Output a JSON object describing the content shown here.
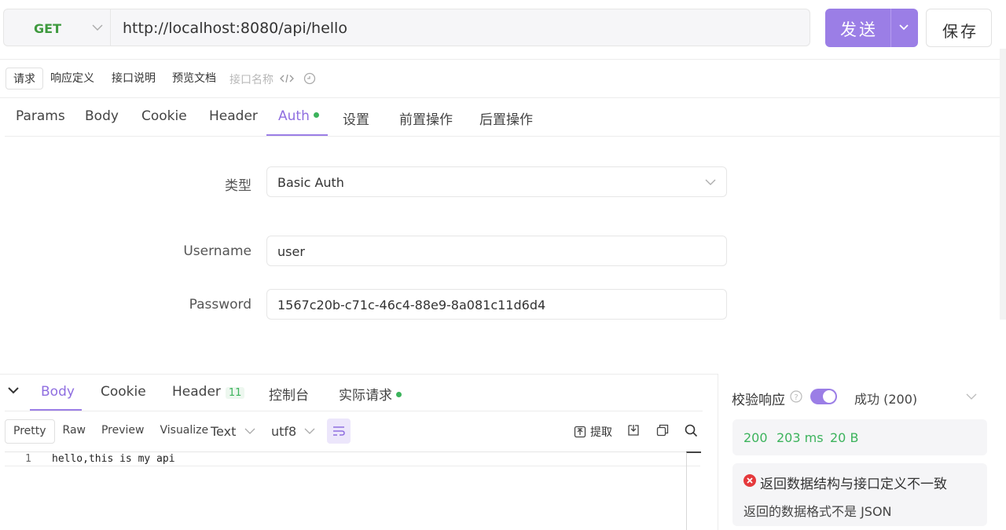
{
  "request": {
    "method": "GET",
    "url": "http://localhost:8080/api/hello",
    "send_label": "发送",
    "save_label": "保存"
  },
  "sub_tabs": [
    "请求",
    "响应定义",
    "接口说明",
    "预览文档"
  ],
  "name_placeholder": "接口名称",
  "request_tabs": [
    "Params",
    "Body",
    "Cookie",
    "Header",
    "Auth",
    "设置",
    "前置操作",
    "后置操作"
  ],
  "auth": {
    "type_label": "类型",
    "type_value": "Basic Auth",
    "username_label": "Username",
    "username_value": "user",
    "password_label": "Password",
    "password_value": "1567c20b-c71c-46c4-88e9-8a081c11d6d4"
  },
  "response": {
    "tabs": [
      "Body",
      "Cookie",
      "Header",
      "控制台",
      "实际请求"
    ],
    "header_count": "11",
    "formats": [
      "Pretty",
      "Raw",
      "Preview",
      "Visualize"
    ],
    "text_select": "Text",
    "encoding_select": "utf8",
    "extract_label": "提取",
    "line_number": "1",
    "body_text": "hello,this is my api"
  },
  "validation": {
    "label": "校验响应",
    "enabled": true,
    "status_text": "成功 (200)",
    "status_code": "200",
    "time": "203 ms",
    "size": "20 B",
    "error_title": "返回数据结构与接口定义不一致",
    "error_detail": "返回的数据格式不是 JSON"
  },
  "colors": {
    "accent": "#9b7ee6",
    "success": "#3cb35c",
    "error": "#e5393c"
  }
}
